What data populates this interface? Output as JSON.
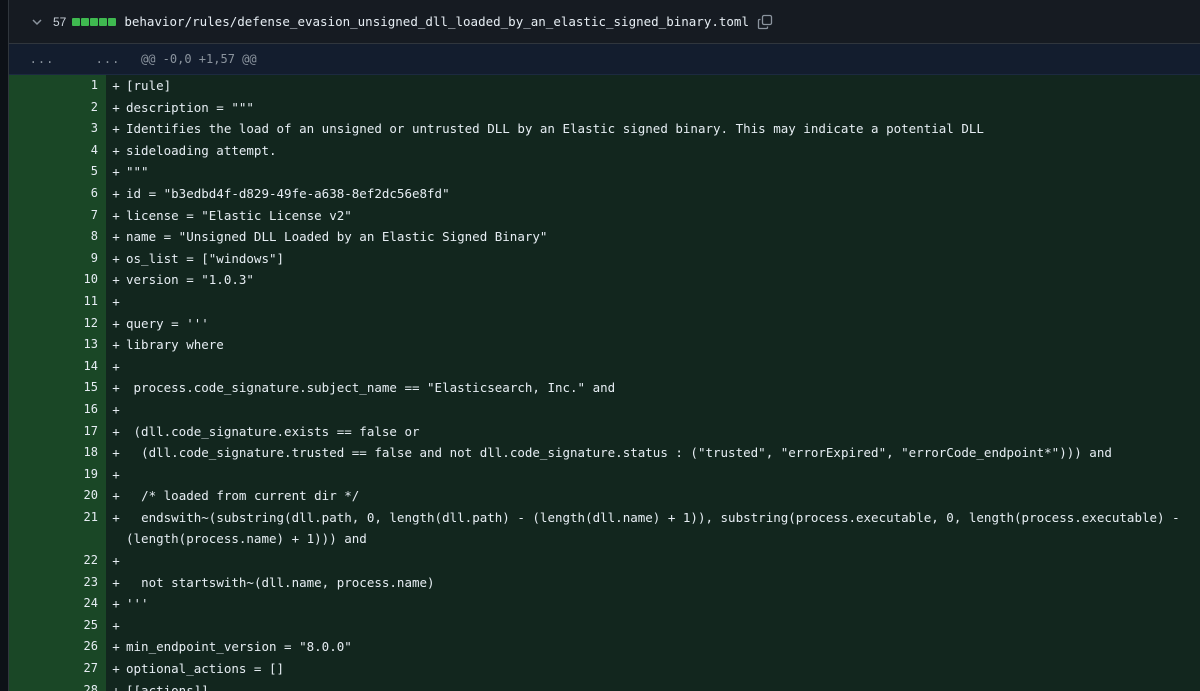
{
  "file": {
    "additions": "57",
    "path": "behavior/rules/defense_evasion_unsigned_dll_loaded_by_an_elastic_signed_binary.toml",
    "diffstat_blocks": 5
  },
  "hunk": {
    "old_expand": "...",
    "new_expand": "...",
    "header": "@@ -0,0 +1,57 @@"
  },
  "lines": [
    {
      "n": "1",
      "code": "[rule]"
    },
    {
      "n": "2",
      "code": "description = \"\"\""
    },
    {
      "n": "3",
      "code": "Identifies the load of an unsigned or untrusted DLL by an Elastic signed binary. This may indicate a potential DLL"
    },
    {
      "n": "4",
      "code": "sideloading attempt."
    },
    {
      "n": "5",
      "code": "\"\"\""
    },
    {
      "n": "6",
      "code": "id = \"b3edbd4f-d829-49fe-a638-8ef2dc56e8fd\""
    },
    {
      "n": "7",
      "code": "license = \"Elastic License v2\""
    },
    {
      "n": "8",
      "code": "name = \"Unsigned DLL Loaded by an Elastic Signed Binary\""
    },
    {
      "n": "9",
      "code": "os_list = [\"windows\"]"
    },
    {
      "n": "10",
      "code": "version = \"1.0.3\""
    },
    {
      "n": "11",
      "code": ""
    },
    {
      "n": "12",
      "code": "query = '''"
    },
    {
      "n": "13",
      "code": "library where"
    },
    {
      "n": "14",
      "code": ""
    },
    {
      "n": "15",
      "code": " process.code_signature.subject_name == \"Elasticsearch, Inc.\" and"
    },
    {
      "n": "16",
      "code": ""
    },
    {
      "n": "17",
      "code": " (dll.code_signature.exists == false or"
    },
    {
      "n": "18",
      "code": "  (dll.code_signature.trusted == false and not dll.code_signature.status : (\"trusted\", \"errorExpired\", \"errorCode_endpoint*\"))) and"
    },
    {
      "n": "19",
      "code": ""
    },
    {
      "n": "20",
      "code": "  /* loaded from current dir */"
    },
    {
      "n": "21",
      "code": "  endswith~(substring(dll.path, 0, length(dll.path) - (length(dll.name) + 1)), substring(process.executable, 0, length(process.executable) -\n(length(process.name) + 1))) and",
      "wrap": true
    },
    {
      "n": "22",
      "code": ""
    },
    {
      "n": "23",
      "code": "  not startswith~(dll.name, process.name)"
    },
    {
      "n": "24",
      "code": "'''"
    },
    {
      "n": "25",
      "code": ""
    },
    {
      "n": "26",
      "code": "min_endpoint_version = \"8.0.0\""
    },
    {
      "n": "27",
      "code": "optional_actions = []"
    },
    {
      "n": "28",
      "code": "[[actions]]"
    }
  ],
  "marker": "+"
}
